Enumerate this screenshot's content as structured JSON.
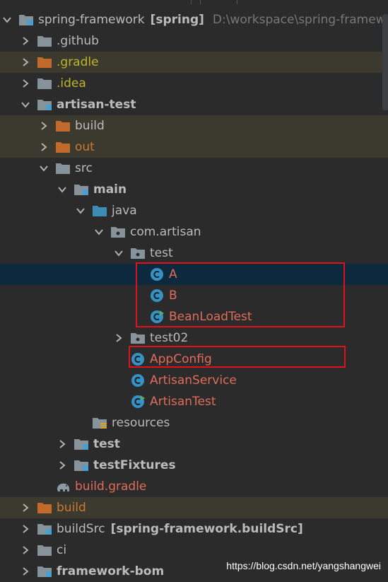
{
  "tree": {
    "root": {
      "name": "spring-framework",
      "module": "[spring]",
      "path": "D:\\workspace\\spring-framework"
    },
    "github": ".github",
    "gradle": ".gradle",
    "idea": ".idea",
    "artisan_test": "artisan-test",
    "build": "build",
    "out": "out",
    "src": "src",
    "main": "main",
    "java": "java",
    "com_artisan": "com.artisan",
    "test_pkg": "test",
    "class_a": "A",
    "class_b": "B",
    "bean_load_test": "BeanLoadTest",
    "test02": "test02",
    "app_config": "AppConfig",
    "artisan_service": "ArtisanService",
    "artisan_test_class": "ArtisanTest",
    "resources": "resources",
    "test_dir": "test",
    "test_fixtures": "testFixtures",
    "build_gradle": "build.gradle",
    "root_build": "build",
    "build_src": "buildSrc",
    "build_src_module": "[spring-framework.buildSrc]",
    "ci": "ci",
    "framework_bom": "framework-bom"
  },
  "watermark": "https://blog.csdn.net/yangshangwei",
  "colors": {
    "background": "#2b2b2b",
    "excluded_row": "#3c3a2f",
    "selected_row": "#0d293e",
    "highlight_box": "#e0111b",
    "folder": "#87939a",
    "orange_folder": "#c16a2c",
    "source_folder": "#3c8cb4",
    "class_icon": "#3592c4"
  }
}
